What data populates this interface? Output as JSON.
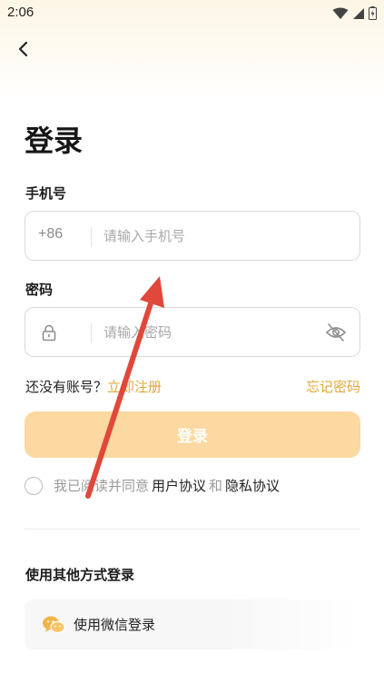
{
  "status_bar": {
    "time": "2:06"
  },
  "header": {
    "title": "登录"
  },
  "phone": {
    "label": "手机号",
    "prefix": "+86",
    "placeholder": "请输入手机号"
  },
  "password": {
    "label": "密码",
    "placeholder": "请输入密码"
  },
  "register": {
    "prompt": "还没有账号？",
    "link": "立即注册"
  },
  "forgot_password": "忘记密码",
  "login_button": "登录",
  "agreement": {
    "prefix": "我已阅读并同意",
    "user_agreement": "用户协议",
    "and": "和",
    "privacy_policy": "隐私协议"
  },
  "other_login": {
    "title": "使用其他方式登录",
    "wechat_label": "使用微信登录"
  },
  "colors": {
    "accent": "#e2a73a",
    "button_disabled": "#fbd9a1",
    "annotation_arrow": "#e0483b"
  }
}
